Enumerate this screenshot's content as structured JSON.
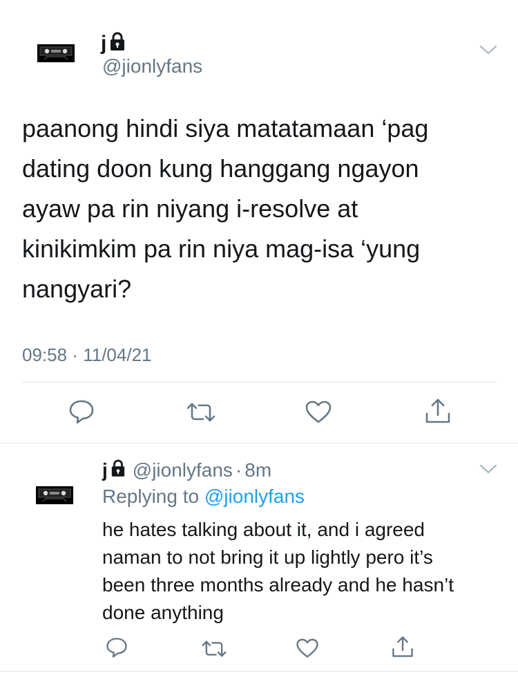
{
  "tweet": {
    "name": "j",
    "handle": "@jionlyfans",
    "text": "paanong hindi siya matatamaan ‘pag\ndating doon kung hanggang ngayon\nayaw pa rin niyang i-resolve at\nkinikimkim pa rin niya mag-isa ‘yung\nnangyari?",
    "time": "09:58",
    "date": "11/04/21",
    "meta_separator": "·"
  },
  "reply": {
    "name": "j",
    "handle": "@jionlyfans",
    "separator": "·",
    "age": "8m",
    "replying_prefix": "Replying to",
    "replying_to": "@jionlyfans",
    "text": "he hates talking about it, and i agreed\nnaman to not bring it up lightly pero it’s\nbeen three months already and he hasn’t\ndone anything"
  },
  "icons": {
    "reply": "speech-bubble-icon",
    "retweet": "retweet-icon",
    "like": "heart-icon",
    "share": "share-icon",
    "more": "chevron-down-icon",
    "protected": "lock-icon",
    "avatar": "cassette-tape-icon"
  },
  "colors": {
    "text": "#14171a",
    "secondary": "#657786",
    "link": "#1da1f2",
    "divider": "#e1e8ed"
  }
}
